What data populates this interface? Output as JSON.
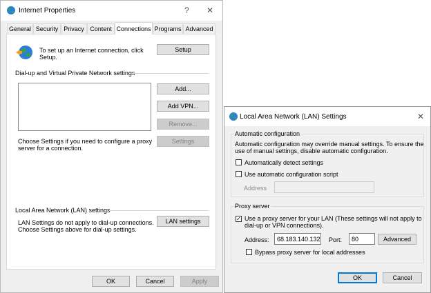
{
  "internet_properties": {
    "title": "Internet Properties",
    "help_glyph": "?",
    "close_glyph": "✕",
    "tabs": [
      "General",
      "Security",
      "Privacy",
      "Content",
      "Connections",
      "Programs",
      "Advanced"
    ],
    "active_tab": "Connections",
    "setup_text_1": "To set up an Internet connection, click",
    "setup_text_2": "Setup.",
    "setup_button": "Setup",
    "dialup_heading": "Dial-up and Virtual Private Network settings",
    "add_button": "Add...",
    "add_vpn_button": "Add VPN...",
    "remove_button": "Remove...",
    "settings_text_1": "Choose Settings if you need to configure a proxy",
    "settings_text_2": "server for a connection.",
    "settings_button": "Settings",
    "lan_heading": "Local Area Network (LAN) settings",
    "lan_text_1": "LAN Settings do not apply to dial-up connections.",
    "lan_text_2": "Choose Settings above for dial-up settings.",
    "lan_settings_button": "LAN settings",
    "ok_button": "OK",
    "cancel_button": "Cancel",
    "apply_button": "Apply"
  },
  "lan_dialog": {
    "title": "Local Area Network (LAN) Settings",
    "close_glyph": "✕",
    "auto_config_heading": "Automatic configuration",
    "auto_config_text_1": "Automatic configuration may override manual settings.  To ensure the",
    "auto_config_text_2": "use of manual settings, disable automatic configuration.",
    "auto_detect_label": "Automatically detect settings",
    "auto_detect_checked": false,
    "auto_script_label": "Use automatic configuration script",
    "auto_script_checked": false,
    "address_label": "Address",
    "address_value": "",
    "proxy_heading": "Proxy server",
    "use_proxy_label_1": "Use a proxy server for your LAN (These settings will not apply to",
    "use_proxy_label_2": "dial-up or VPN connections).",
    "use_proxy_checked": true,
    "check_glyph": "✓",
    "proxy_address_label": "Address:",
    "proxy_address_value": "68.183.140.132",
    "port_label": "Port:",
    "port_value": "80",
    "advanced_button": "Advanced",
    "bypass_label": "Bypass proxy server for local addresses",
    "bypass_checked": false,
    "ok_button": "OK",
    "cancel_button": "Cancel"
  },
  "icons": {
    "app_icon": "globe-network-icon",
    "setup_icon": "globe-setup-icon"
  },
  "colors": {
    "accent": "#0078d7",
    "globe_blue": "#2b7fd6",
    "globe_green": "#3aa24a",
    "arrow_orange": "#f0a020"
  }
}
